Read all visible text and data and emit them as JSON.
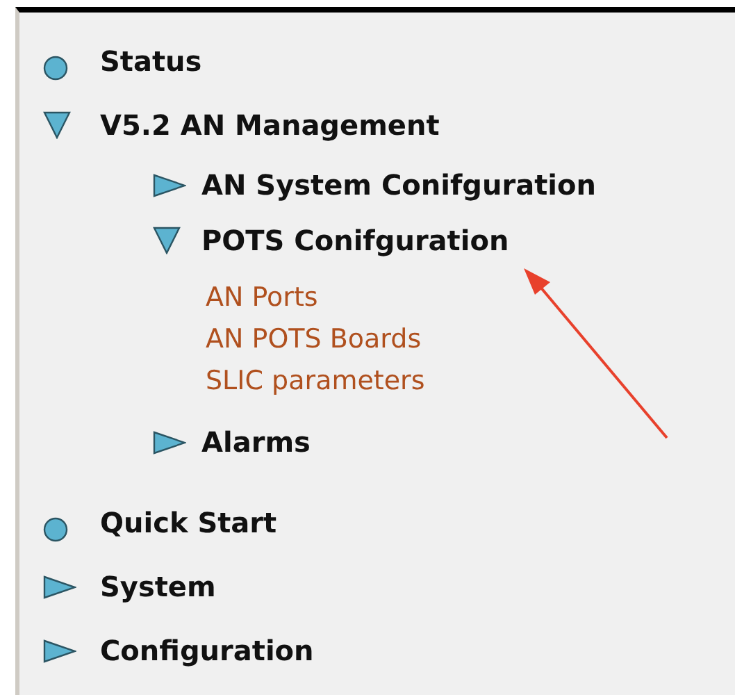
{
  "nav": {
    "items": [
      {
        "kind": "leaf",
        "label": "Status"
      },
      {
        "kind": "folder",
        "label": "V5.2 AN Management",
        "expanded": true,
        "children": [
          {
            "kind": "folder",
            "label": "AN System Conifguration",
            "expanded": false
          },
          {
            "kind": "folder",
            "label": "POTS Conifguration",
            "expanded": true,
            "children": [
              {
                "kind": "link",
                "label": "AN Ports"
              },
              {
                "kind": "link",
                "label": "AN POTS Boards"
              },
              {
                "kind": "link",
                "label": "SLIC parameters"
              }
            ]
          },
          {
            "kind": "folder",
            "label": "Alarms",
            "expanded": false
          }
        ]
      },
      {
        "kind": "leaf",
        "label": "Quick Start"
      },
      {
        "kind": "folder",
        "label": "System",
        "expanded": false
      },
      {
        "kind": "folder",
        "label": "Configuration",
        "expanded": false
      }
    ]
  }
}
